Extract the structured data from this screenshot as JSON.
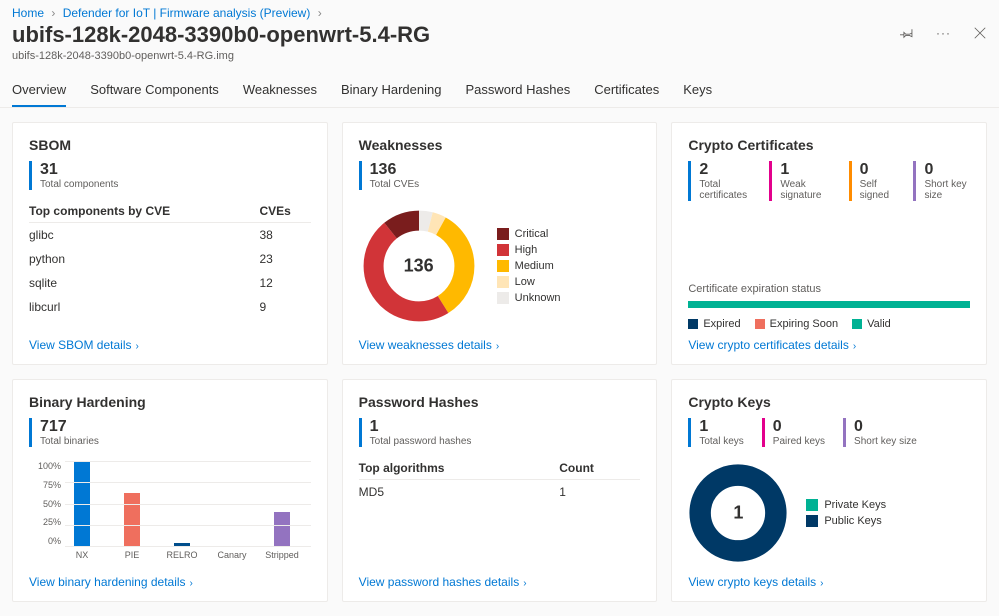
{
  "breadcrumb": {
    "home": "Home",
    "l1": "Defender for IoT | Firmware analysis (Preview)"
  },
  "header": {
    "title": "ubifs-128k-2048-3390b0-openwrt-5.4-RG",
    "subtitle": "ubifs-128k-2048-3390b0-openwrt-5.4-RG.img"
  },
  "tabs": {
    "overview": "Overview",
    "software": "Software Components",
    "weaknesses": "Weaknesses",
    "binary": "Binary Hardening",
    "password": "Password Hashes",
    "certificates": "Certificates",
    "keys": "Keys"
  },
  "sbom": {
    "title": "SBOM",
    "count": "31",
    "count_lbl": "Total components",
    "col_a": "Top components by CVE",
    "col_b": "CVEs",
    "rows": [
      {
        "name": "glibc",
        "cve": "38"
      },
      {
        "name": "python",
        "cve": "23"
      },
      {
        "name": "sqlite",
        "cve": "12"
      },
      {
        "name": "libcurl",
        "cve": "9"
      }
    ],
    "link": "View SBOM details"
  },
  "weak": {
    "title": "Weaknesses",
    "count": "136",
    "count_lbl": "Total CVEs",
    "center": "136",
    "legend": {
      "critical": "Critical",
      "high": "High",
      "medium": "Medium",
      "low": "Low",
      "unknown": "Unknown"
    },
    "link": "View weaknesses details"
  },
  "certs": {
    "title": "Crypto Certificates",
    "a_num": "2",
    "a_lbl": "Total certificates",
    "b_num": "1",
    "b_lbl": "Weak signature",
    "c_num": "0",
    "c_lbl": "Self signed",
    "d_num": "0",
    "d_lbl": "Short key size",
    "status_lbl": "Certificate expiration status",
    "leg_expired": "Expired",
    "leg_soon": "Expiring Soon",
    "leg_valid": "Valid",
    "link": "View crypto certificates details"
  },
  "binhard": {
    "title": "Binary Hardening",
    "count": "717",
    "count_lbl": "Total binaries",
    "axis": {
      "a": "100%",
      "b": "75%",
      "c": "50%",
      "d": "25%",
      "e": "0%"
    },
    "bars": {
      "nx": {
        "lbl": "NX",
        "pct": 100,
        "color": "#0078d4"
      },
      "pie": {
        "lbl": "PIE",
        "pct": 62,
        "color": "#ef6f5e"
      },
      "relro": {
        "lbl": "RELRO",
        "pct": 3,
        "color": "#004e8c"
      },
      "canary": {
        "lbl": "Canary",
        "pct": 0,
        "color": "#9373c0"
      },
      "stripped": {
        "lbl": "Stripped",
        "pct": 40,
        "color": "#9373c0"
      }
    },
    "link": "View binary hardening details"
  },
  "pwhash": {
    "title": "Password Hashes",
    "count": "1",
    "count_lbl": "Total password hashes",
    "col_a": "Top algorithms",
    "col_b": "Count",
    "row_name": "MD5",
    "row_count": "1",
    "link": "View password hashes details"
  },
  "ckeys": {
    "title": "Crypto Keys",
    "a_num": "1",
    "a_lbl": "Total keys",
    "b_num": "0",
    "b_lbl": "Paired keys",
    "c_num": "0",
    "c_lbl": "Short key size",
    "center": "1",
    "leg_private": "Private Keys",
    "leg_public": "Public Keys",
    "link": "View crypto keys details"
  },
  "chart_data": [
    {
      "type": "pie",
      "title": "Weaknesses",
      "series": [
        {
          "name": "Critical",
          "value": 15,
          "color": "#7a1d1d"
        },
        {
          "name": "High",
          "value": 65,
          "color": "#d13438"
        },
        {
          "name": "Medium",
          "value": 45,
          "color": "#ffb900"
        },
        {
          "name": "Low",
          "value": 6,
          "color": "#ffe5b6"
        },
        {
          "name": "Unknown",
          "value": 5,
          "color": "#edebe9"
        }
      ],
      "total": 136
    },
    {
      "type": "bar",
      "title": "Binary Hardening",
      "categories": [
        "NX",
        "PIE",
        "RELRO",
        "Canary",
        "Stripped"
      ],
      "values": [
        100,
        62,
        3,
        0,
        40
      ],
      "ylabel": "%",
      "ylim": [
        0,
        100
      ]
    },
    {
      "type": "bar",
      "title": "Certificate expiration status",
      "categories": [
        "Expired",
        "Expiring Soon",
        "Valid"
      ],
      "values": [
        0,
        0,
        2
      ]
    },
    {
      "type": "pie",
      "title": "Crypto Keys",
      "series": [
        {
          "name": "Private Keys",
          "value": 0,
          "color": "#00b294"
        },
        {
          "name": "Public Keys",
          "value": 1,
          "color": "#003966"
        }
      ],
      "total": 1
    }
  ]
}
